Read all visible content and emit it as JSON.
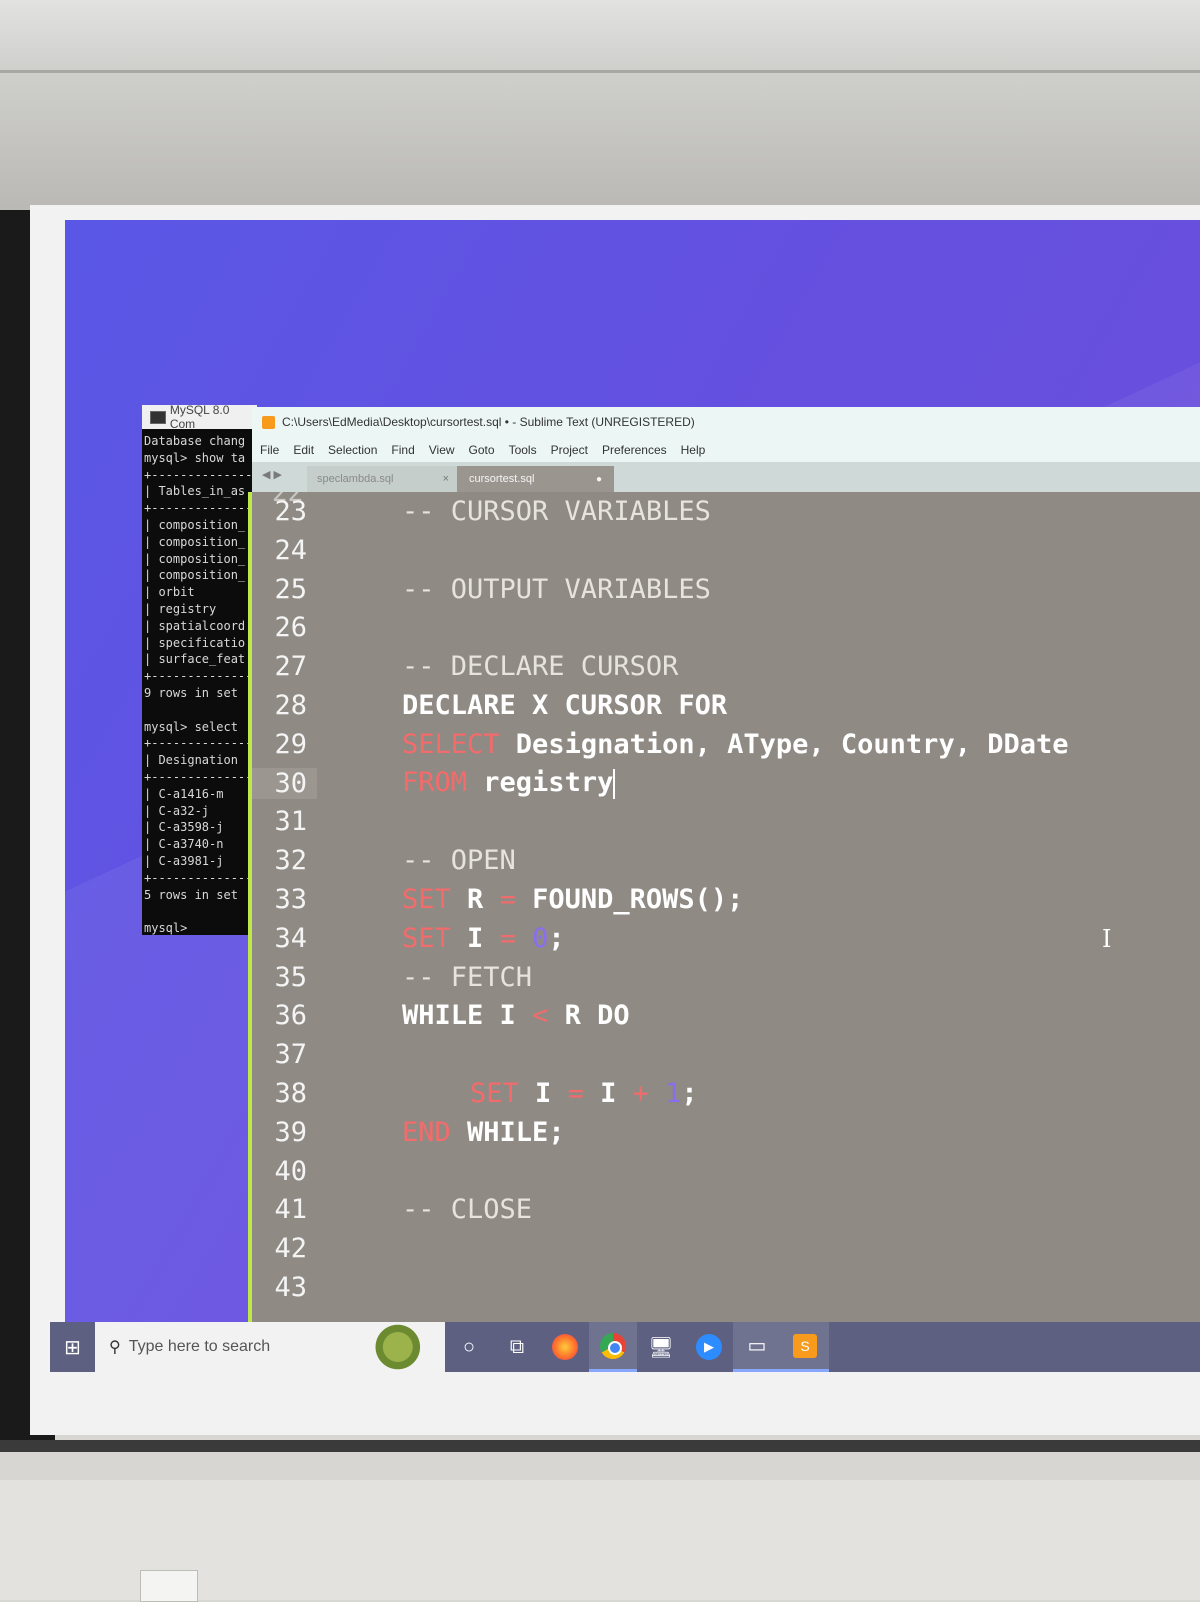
{
  "mysql": {
    "title": "MySQL 8.0 Com",
    "lines": [
      "Database chang",
      "mysql> show ta",
      "+--------------",
      "| Tables_in_as",
      "+--------------",
      "| composition_",
      "| composition_",
      "| composition_",
      "| composition_",
      "| orbit",
      "| registry",
      "| spatialcoord",
      "| specificatio",
      "| surface_feat",
      "+--------------",
      "9 rows in set",
      "",
      "mysql> select",
      "+--------------",
      "| Designation",
      "+--------------",
      "| C-a1416-m",
      "| C-a32-j",
      "| C-a3598-j",
      "| C-a3740-n",
      "| C-a3981-j",
      "+--------------",
      "5 rows in set",
      "",
      "mysql>"
    ]
  },
  "sublime": {
    "title": "C:\\Users\\EdMedia\\Desktop\\cursortest.sql • - Sublime Text (UNREGISTERED)",
    "menu": [
      "File",
      "Edit",
      "Selection",
      "Find",
      "View",
      "Goto",
      "Tools",
      "Project",
      "Preferences",
      "Help"
    ],
    "tabs": [
      {
        "label": "speclambda.sql",
        "close": "×"
      },
      {
        "label": "cursortest.sql",
        "modified": "●"
      }
    ],
    "gutter_partial": "22",
    "lines": [
      {
        "n": "23",
        "segments": [
          {
            "t": "-- CURSOR VARIABLES",
            "c": "cmt"
          }
        ]
      },
      {
        "n": "24",
        "segments": []
      },
      {
        "n": "25",
        "segments": [
          {
            "t": "-- OUTPUT VARIABLES",
            "c": "cmt"
          }
        ]
      },
      {
        "n": "26",
        "segments": []
      },
      {
        "n": "27",
        "segments": [
          {
            "t": "-- DECLARE CURSOR",
            "c": "cmt"
          }
        ]
      },
      {
        "n": "28",
        "segments": [
          {
            "t": "DECLARE X CURSOR FOR",
            "c": ""
          }
        ]
      },
      {
        "n": "29",
        "segments": [
          {
            "t": "SELECT",
            "c": "kw"
          },
          {
            "t": " Designation, AType, Country, DDate",
            "c": ""
          }
        ]
      },
      {
        "n": "30",
        "segments": [
          {
            "t": "FROM",
            "c": "kw"
          },
          {
            "t": " registry",
            "c": ""
          }
        ]
      },
      {
        "n": "31",
        "segments": []
      },
      {
        "n": "32",
        "segments": [
          {
            "t": "-- OPEN",
            "c": "cmt"
          }
        ]
      },
      {
        "n": "33",
        "segments": [
          {
            "t": "SET",
            "c": "kw"
          },
          {
            "t": " R ",
            "c": ""
          },
          {
            "t": "=",
            "c": "op"
          },
          {
            "t": " FOUND_ROWS();",
            "c": ""
          }
        ]
      },
      {
        "n": "34",
        "segments": [
          {
            "t": "SET",
            "c": "kw"
          },
          {
            "t": " I ",
            "c": ""
          },
          {
            "t": "=",
            "c": "op"
          },
          {
            "t": " ",
            "c": ""
          },
          {
            "t": "0",
            "c": "num"
          },
          {
            "t": ";",
            "c": ""
          }
        ]
      },
      {
        "n": "35",
        "segments": [
          {
            "t": "-- FETCH",
            "c": "cmt"
          }
        ]
      },
      {
        "n": "36",
        "segments": [
          {
            "t": "WHILE I ",
            "c": ""
          },
          {
            "t": "<",
            "c": "op"
          },
          {
            "t": " R DO",
            "c": ""
          }
        ]
      },
      {
        "n": "37",
        "segments": []
      },
      {
        "n": "38",
        "indent": true,
        "segments": [
          {
            "t": "SET",
            "c": "kw"
          },
          {
            "t": " I ",
            "c": ""
          },
          {
            "t": "=",
            "c": "op"
          },
          {
            "t": " I ",
            "c": ""
          },
          {
            "t": "+",
            "c": "op"
          },
          {
            "t": " ",
            "c": ""
          },
          {
            "t": "1",
            "c": "num"
          },
          {
            "t": ";",
            "c": ""
          }
        ]
      },
      {
        "n": "39",
        "segments": [
          {
            "t": "END",
            "c": "kw"
          },
          {
            "t": " WHILE;",
            "c": ""
          }
        ]
      },
      {
        "n": "40",
        "segments": []
      },
      {
        "n": "41",
        "segments": [
          {
            "t": "-- CLOSE",
            "c": "cmt"
          }
        ]
      },
      {
        "n": "42",
        "segments": []
      },
      {
        "n": "43",
        "segments": []
      }
    ],
    "active_line": "30",
    "cursor_line": "30"
  },
  "taskbar": {
    "search_placeholder": "Type here to search",
    "icons": [
      "windows-start-icon",
      "search-icon",
      "cortana-icon",
      "task-view-icon",
      "firefox-icon",
      "chrome-icon",
      "network-icon",
      "zoom-icon",
      "terminal-icon",
      "sublime-icon"
    ]
  },
  "colors": {
    "desktop": "#6050e0",
    "editor_bg": "#8f8a84",
    "keyword": "#f46b6b",
    "number": "#8a6ef0",
    "gutter_accent": "#bfe94a"
  }
}
